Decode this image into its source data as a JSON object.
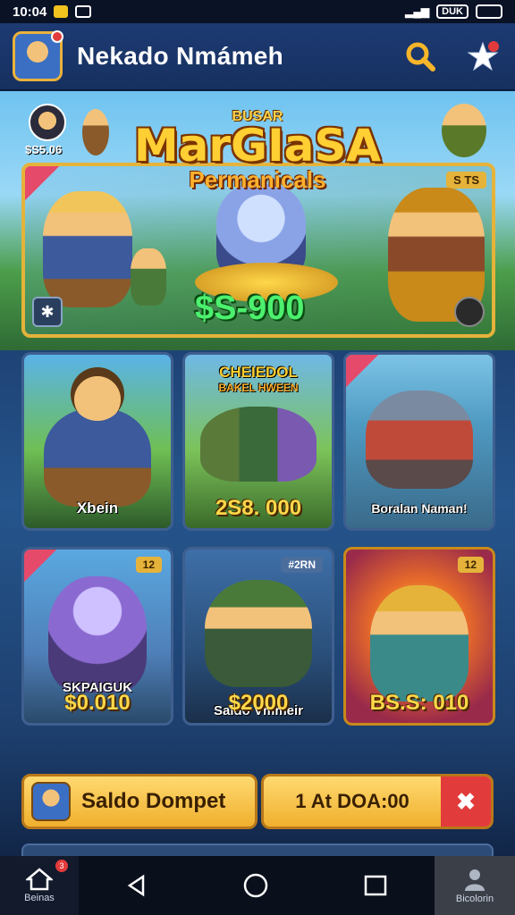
{
  "status_bar": {
    "time": "10:04",
    "battery_label": "DUK"
  },
  "header": {
    "title": "Nekado Nmámeh"
  },
  "banner": {
    "kicker": "BUSAR",
    "title": "MarGIaSA",
    "subtitle": "Permanicals",
    "player_amount": "$S5.06",
    "corner_tag": "S TS",
    "price": "$S-900"
  },
  "cards": [
    {
      "label": "Xbein",
      "price": "",
      "tag": ""
    },
    {
      "label": "CHEIEDOL",
      "sublabel": "BAKEL HWEEN",
      "price": "2S8. 000",
      "tag": ""
    },
    {
      "label": "Boralan Naman!",
      "price": "",
      "tag": ""
    },
    {
      "label": "SKPAIGUK",
      "price": "$0.010",
      "tag": "12"
    },
    {
      "label": "Saldo Vmmeir",
      "price": "$2000",
      "tag": "#2RN"
    },
    {
      "label": "",
      "price": "BS.S: 010",
      "tag": "12"
    }
  ],
  "actions": {
    "wallet_label": "Saldo Dompet",
    "right_label": "1 At DOA:00",
    "close_glyph": "✖"
  },
  "navbar": {
    "home_label": "Beinas",
    "home_badge": "3",
    "profile_label": "Bicolorin"
  },
  "colors": {
    "gold": "#f0b02e",
    "accent_red": "#e23b3b",
    "price_green": "#4cf06e"
  }
}
